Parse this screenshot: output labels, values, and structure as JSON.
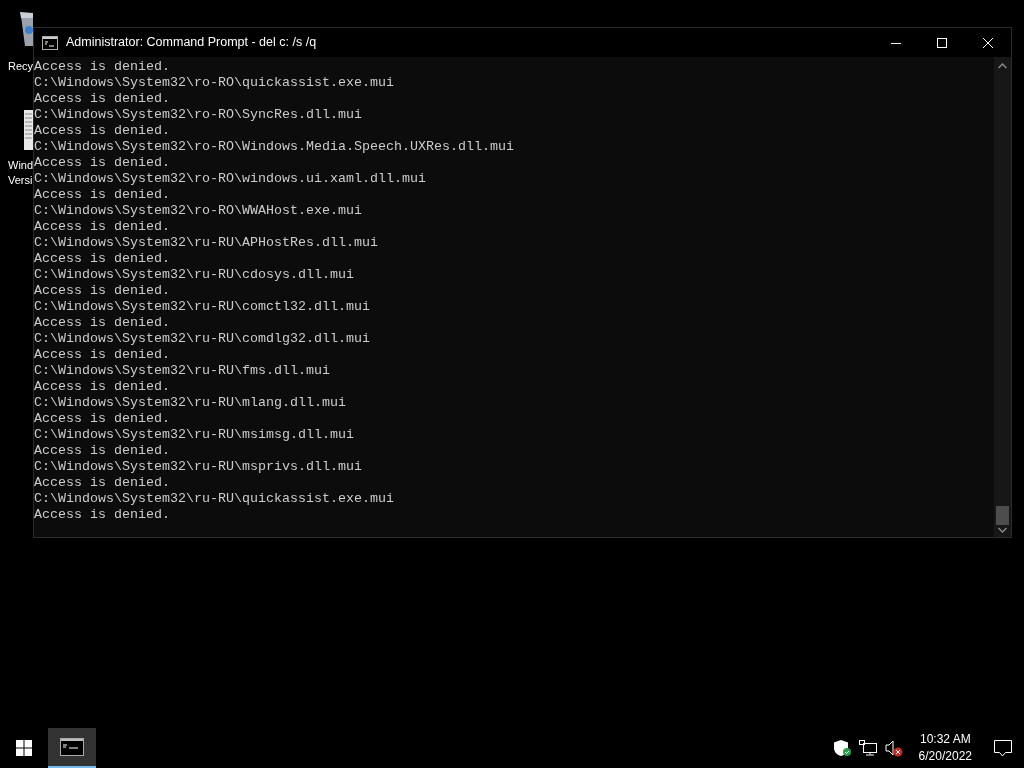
{
  "desktop_icons": [
    {
      "label_lines": [
        "Recy"
      ]
    },
    {
      "label_lines": [
        "Wind",
        "Versi"
      ]
    }
  ],
  "window": {
    "title": "Administrator: Command Prompt - del  c: /s /q",
    "console_lines": [
      "Access is denied.",
      "C:\\Windows\\System32\\ro-RO\\quickassist.exe.mui",
      "Access is denied.",
      "C:\\Windows\\System32\\ro-RO\\SyncRes.dll.mui",
      "Access is denied.",
      "C:\\Windows\\System32\\ro-RO\\Windows.Media.Speech.UXRes.dll.mui",
      "Access is denied.",
      "C:\\Windows\\System32\\ro-RO\\windows.ui.xaml.dll.mui",
      "Access is denied.",
      "C:\\Windows\\System32\\ro-RO\\WWAHost.exe.mui",
      "Access is denied.",
      "C:\\Windows\\System32\\ru-RU\\APHostRes.dll.mui",
      "Access is denied.",
      "C:\\Windows\\System32\\ru-RU\\cdosys.dll.mui",
      "Access is denied.",
      "C:\\Windows\\System32\\ru-RU\\comctl32.dll.mui",
      "Access is denied.",
      "C:\\Windows\\System32\\ru-RU\\comdlg32.dll.mui",
      "Access is denied.",
      "C:\\Windows\\System32\\ru-RU\\fms.dll.mui",
      "Access is denied.",
      "C:\\Windows\\System32\\ru-RU\\mlang.dll.mui",
      "Access is denied.",
      "C:\\Windows\\System32\\ru-RU\\msimsg.dll.mui",
      "Access is denied.",
      "C:\\Windows\\System32\\ru-RU\\msprivs.dll.mui",
      "Access is denied.",
      "C:\\Windows\\System32\\ru-RU\\quickassist.exe.mui",
      "Access is denied."
    ]
  },
  "taskbar": {
    "apps": [
      {
        "selected": true
      }
    ],
    "clock_time": "10:32 AM",
    "clock_date": "6/20/2022"
  }
}
